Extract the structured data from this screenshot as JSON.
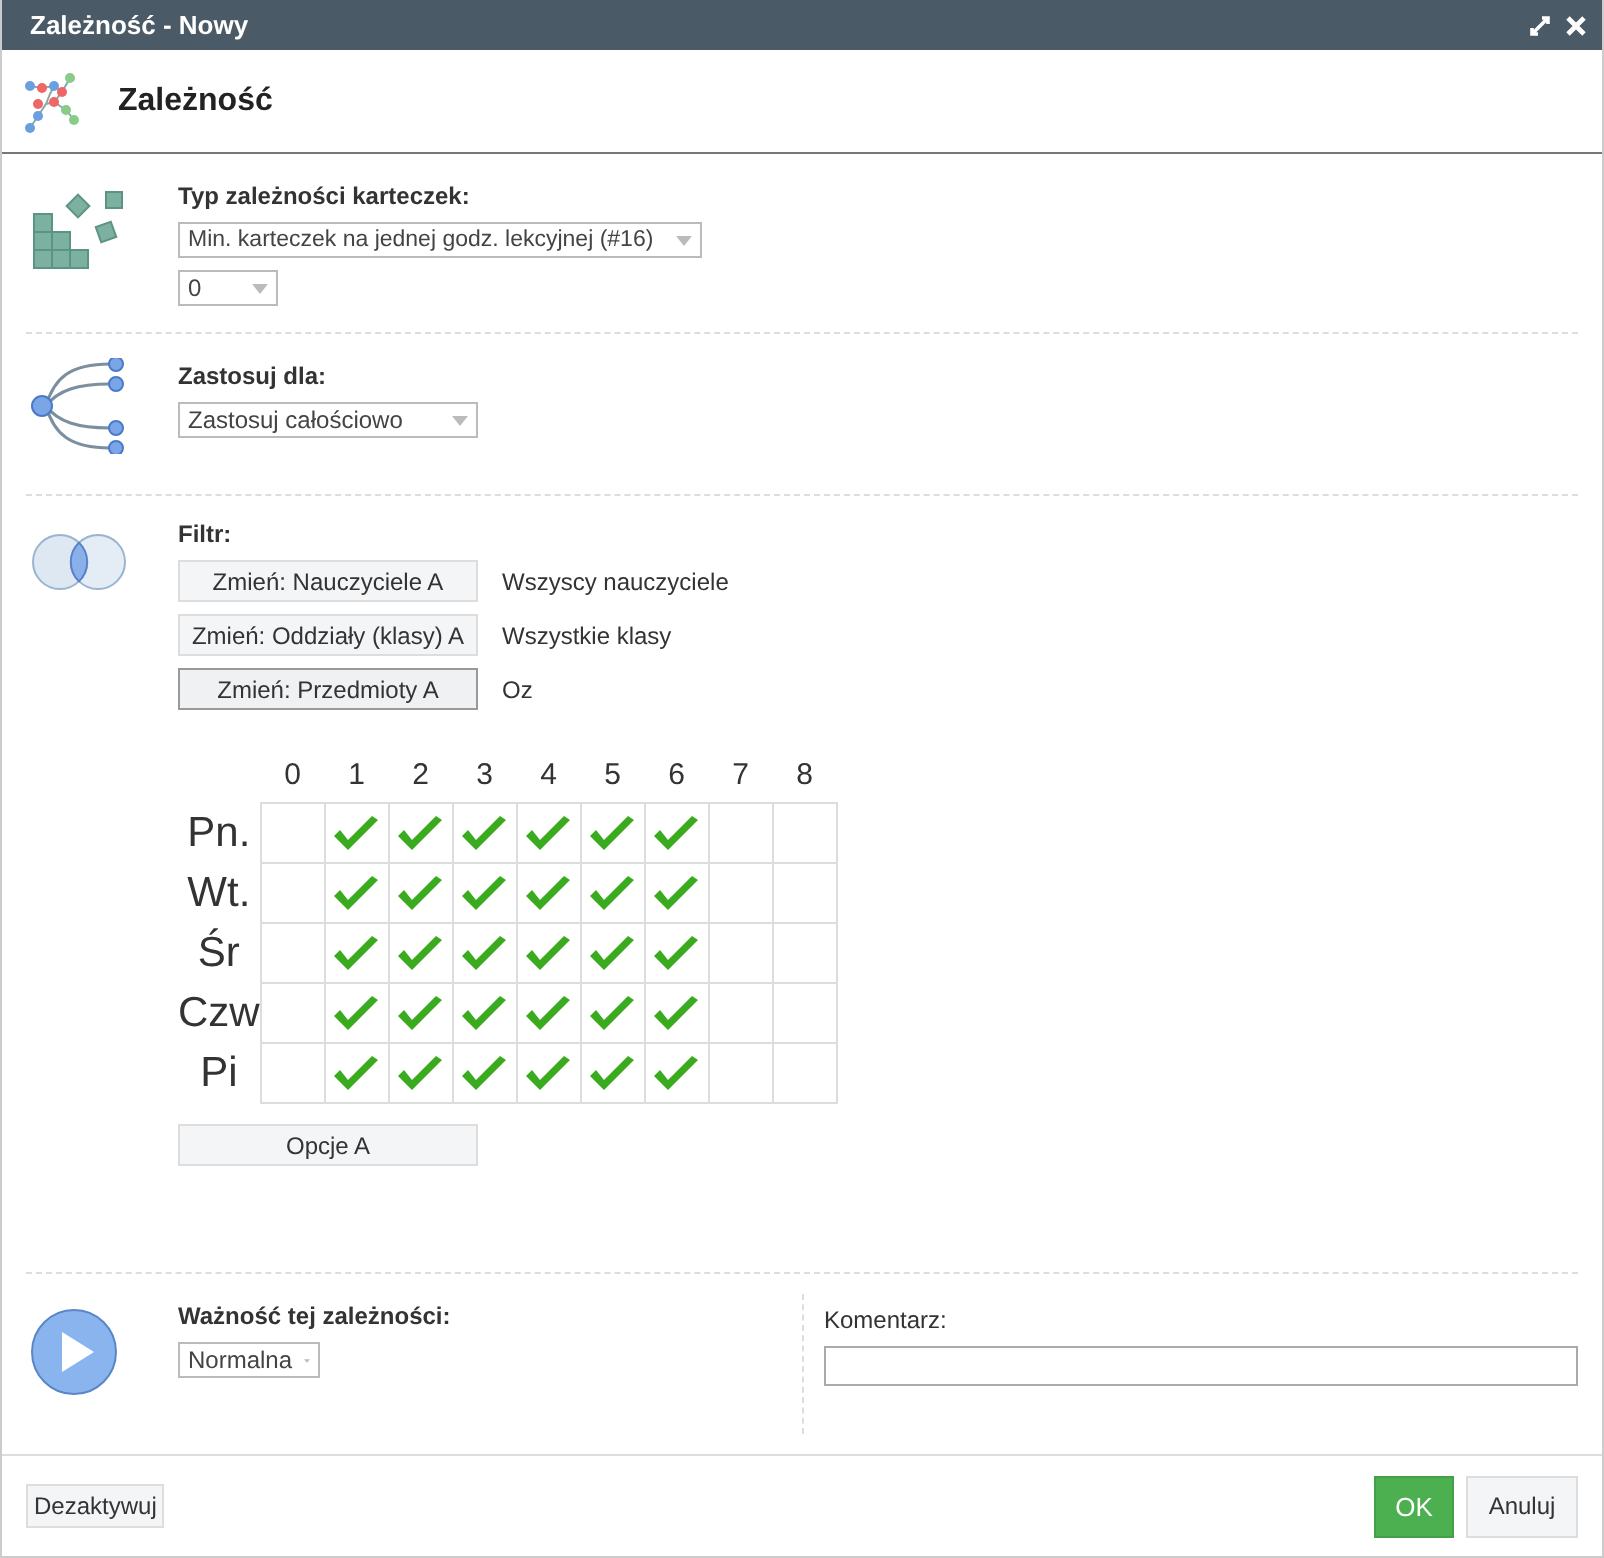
{
  "window": {
    "title": "Zależność - Nowy"
  },
  "header": {
    "title": "Zależność"
  },
  "type_section": {
    "label": "Typ zależności karteczek:",
    "type_value": "Min. karteczek na jednej godz. lekcyjnej (#16)",
    "count_value": "0"
  },
  "apply_section": {
    "label": "Zastosuj dla:",
    "value": "Zastosuj całościowo"
  },
  "filter_section": {
    "label": "Filtr:",
    "filters": [
      {
        "button": "Zmień: Nauczyciele A",
        "value": "Wszyscy nauczyciele",
        "selected": false
      },
      {
        "button": "Zmień: Oddziały (klasy) A",
        "value": "Wszystkie klasy",
        "selected": false
      },
      {
        "button": "Zmień: Przedmioty A",
        "value": "Oz",
        "selected": true
      }
    ],
    "grid": {
      "columns": [
        "0",
        "1",
        "2",
        "3",
        "4",
        "5",
        "6",
        "7",
        "8"
      ],
      "rows": [
        {
          "day": "Pn.",
          "checked": [
            false,
            true,
            true,
            true,
            true,
            true,
            true,
            false,
            false
          ]
        },
        {
          "day": "Wt.",
          "checked": [
            false,
            true,
            true,
            true,
            true,
            true,
            true,
            false,
            false
          ]
        },
        {
          "day": "Śr",
          "checked": [
            false,
            true,
            true,
            true,
            true,
            true,
            true,
            false,
            false
          ]
        },
        {
          "day": "Czw",
          "checked": [
            false,
            true,
            true,
            true,
            true,
            true,
            true,
            false,
            false
          ]
        },
        {
          "day": "Pi",
          "checked": [
            false,
            true,
            true,
            true,
            true,
            true,
            true,
            false,
            false
          ]
        }
      ]
    },
    "options_button": "Opcje A"
  },
  "importance": {
    "label": "Ważność tej zależności:",
    "value": "Normalna"
  },
  "comment": {
    "label": "Komentarz:"
  },
  "footer": {
    "deactivate": "Dezaktywuj",
    "ok": "OK",
    "cancel": "Anuluj"
  }
}
